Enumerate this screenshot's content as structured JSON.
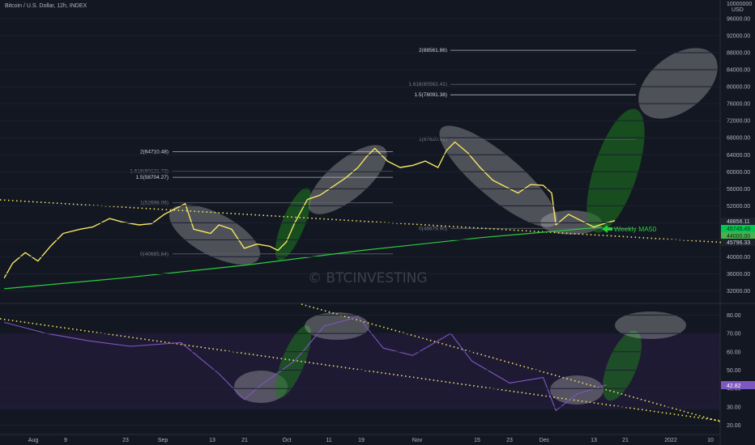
{
  "header": {
    "title": "Bitcoin / U.S. Dollar, 12h, INDEX"
  },
  "price_axis": {
    "unit_top": "10000000",
    "unit_bottom": "USD",
    "ticks": [
      "96000.00",
      "92000.00",
      "88000.00",
      "84000.00",
      "80000.00",
      "76000.00",
      "72000.00",
      "68000.00",
      "64000.00",
      "60000.00",
      "56000.00",
      "52000.00",
      "48000.00",
      "44000.00",
      "40000.00",
      "36000.00",
      "32000.00"
    ],
    "badges": [
      {
        "text": "48856.11",
        "color": "#1e222d",
        "text_color": "#d1d4dc"
      },
      {
        "text": "45745.49",
        "color": "#00c853",
        "text_color": "#0b2a12"
      },
      {
        "text": "44000.00",
        "color": "#4caf50",
        "text_color": "#0b2a12"
      },
      {
        "text": "45796.33",
        "color": "#1e222d",
        "text_color": "#d1d4dc"
      }
    ]
  },
  "rsi_axis": {
    "ticks": [
      "80.00",
      "70.00",
      "60.00",
      "50.00",
      "40.00",
      "30.00",
      "20.00"
    ],
    "badge": {
      "text": "42.82",
      "color": "#7e57c2",
      "text_color": "#ffffff"
    }
  },
  "time_axis": {
    "ticks": [
      "Aug",
      "9",
      "23",
      "Sep",
      "13",
      "21",
      "Oct",
      "11",
      "19",
      "Nov",
      "15",
      "23",
      "Dec",
      "13",
      "21",
      "2022",
      "10"
    ]
  },
  "fib_levels": [
    {
      "label": "2(88561.86)",
      "value": 88561.86,
      "bright": true
    },
    {
      "label": "1.618(80562.41)",
      "value": 80562.41,
      "bright": false
    },
    {
      "label": "1.5(78091.38)",
      "value": 78091.38,
      "bright": true
    },
    {
      "label": "1(67620.91)",
      "value": 67620.91,
      "bright": false
    },
    {
      "label": "0(46679.90)",
      "value": 46679.9,
      "bright": false
    },
    {
      "label": "2(64710.48)",
      "value": 64710.48,
      "bright": true
    },
    {
      "label": "1.618(60121.73)",
      "value": 60121.73,
      "bright": false
    },
    {
      "label": "1.5(58704.27)",
      "value": 58704.27,
      "bright": true
    },
    {
      "label": "1(52698.06)",
      "value": 52698.06,
      "bright": false
    },
    {
      "label": "0(40685.64)",
      "value": 40685.64,
      "bright": false
    }
  ],
  "annotations": {
    "watermark": "© BTCINVESTING",
    "ma_label": "Weekly MA50"
  },
  "colors": {
    "background": "#131722",
    "price_line": "#f5e663",
    "ma_line": "#2ecc40",
    "rsi_line": "#7e57c2",
    "trend_dots": "#f5e663",
    "ellipse_gray": "#c8c8c8",
    "ellipse_green": "#1e7a1e"
  },
  "chart_data": {
    "type": "line",
    "title": "Bitcoin / U.S. Dollar, 12h, INDEX",
    "x_range": [
      "2021-07-25",
      "2022-01-12"
    ],
    "price_range": [
      30000,
      100000
    ],
    "rsi_range": [
      15,
      85
    ],
    "series": [
      {
        "name": "BTC price",
        "x": [
          "2021-07-26",
          "2021-07-28",
          "2021-07-31",
          "2021-08-03",
          "2021-08-06",
          "2021-08-09",
          "2021-08-13",
          "2021-08-16",
          "2021-08-20",
          "2021-08-23",
          "2021-08-27",
          "2021-08-30",
          "2021-09-02",
          "2021-09-05",
          "2021-09-07",
          "2021-09-09",
          "2021-09-13",
          "2021-09-15",
          "2021-09-18",
          "2021-09-21",
          "2021-09-24",
          "2021-09-27",
          "2021-09-29",
          "2021-10-01",
          "2021-10-03",
          "2021-10-06",
          "2021-10-09",
          "2021-10-12",
          "2021-10-15",
          "2021-10-18",
          "2021-10-20",
          "2021-10-22",
          "2021-10-25",
          "2021-10-28",
          "2021-10-31",
          "2021-11-03",
          "2021-11-06",
          "2021-11-08",
          "2021-11-10",
          "2021-11-13",
          "2021-11-16",
          "2021-11-19",
          "2021-11-22",
          "2021-11-25",
          "2021-11-28",
          "2021-12-01",
          "2021-12-03",
          "2021-12-04",
          "2021-12-07",
          "2021-12-10",
          "2021-12-13",
          "2021-12-16",
          "2021-12-18"
        ],
        "values": [
          35000,
          38500,
          41000,
          39000,
          42500,
          45500,
          46500,
          47000,
          49000,
          48200,
          47500,
          47800,
          50000,
          51500,
          52500,
          46500,
          45500,
          47500,
          46500,
          42000,
          43000,
          42500,
          41500,
          43500,
          48000,
          53500,
          54500,
          56500,
          58500,
          61000,
          63500,
          65500,
          62500,
          61000,
          61500,
          62500,
          61000,
          65000,
          67000,
          64500,
          61000,
          58000,
          56500,
          55000,
          57000,
          56800,
          55000,
          47500,
          50000,
          48500,
          47000,
          48000,
          48500
        ]
      },
      {
        "name": "Weekly MA50",
        "x": [
          "2021-07-26",
          "2021-08-23",
          "2021-09-21",
          "2021-10-19",
          "2021-11-16",
          "2021-12-15"
        ],
        "values": [
          32500,
          35000,
          38000,
          41500,
          44500,
          47000
        ]
      },
      {
        "name": "RSI",
        "x": [
          "2021-07-26",
          "2021-08-05",
          "2021-08-15",
          "2021-08-25",
          "2021-09-06",
          "2021-09-15",
          "2021-09-21",
          "2021-09-25",
          "2021-10-03",
          "2021-10-10",
          "2021-10-18",
          "2021-10-24",
          "2021-10-31",
          "2021-11-09",
          "2021-11-14",
          "2021-11-23",
          "2021-12-01",
          "2021-12-04",
          "2021-12-09",
          "2021-12-16"
        ],
        "values": [
          76,
          70,
          66,
          63,
          65,
          48,
          34,
          42,
          55,
          74,
          79,
          62,
          58,
          70,
          55,
          43,
          46,
          28,
          37,
          42
        ]
      }
    ]
  }
}
